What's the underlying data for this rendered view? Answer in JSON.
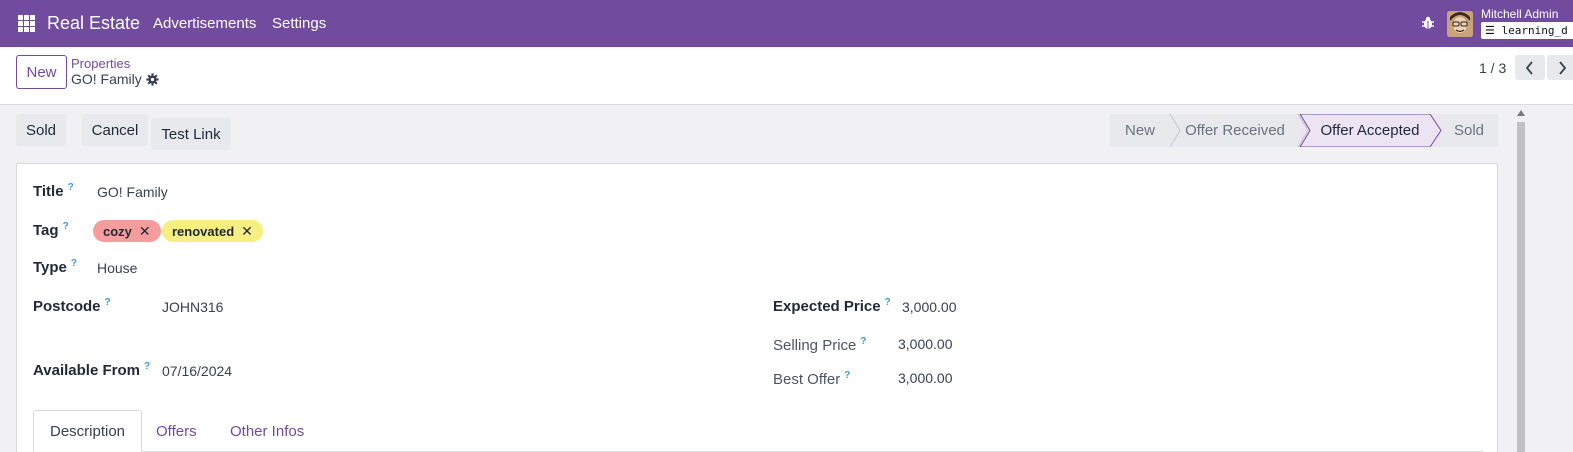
{
  "navbar": {
    "brand": "Real Estate",
    "menu": [
      "Advertisements",
      "Settings"
    ],
    "user_name": "Mitchell Admin",
    "database": "learning_d",
    "color": "#714b9e"
  },
  "control_panel": {
    "new_label": "New",
    "breadcrumb": "Properties",
    "record_name": "GO! Family",
    "pager": "1 / 3"
  },
  "actions": {
    "sold": "Sold",
    "cancel": "Cancel",
    "test_link": "Test Link"
  },
  "statusbar": {
    "stages": [
      "New",
      "Offer Received",
      "Offer Accepted",
      "Sold"
    ],
    "active": "Offer Accepted"
  },
  "form": {
    "title_label": "Title",
    "title_value": "GO! Family",
    "tag_label": "Tag",
    "tags": [
      {
        "name": "cozy",
        "color": "#f59c9c"
      },
      {
        "name": "renovated",
        "color": "#f7ef82"
      }
    ],
    "type_label": "Type",
    "type_value": "House",
    "postcode_label": "Postcode",
    "postcode_value": "JOHN316",
    "available_label": "Available From",
    "available_value": "07/16/2024",
    "expected_label": "Expected Price",
    "expected_value": "3,000.00",
    "selling_label": "Selling Price",
    "selling_value": "3,000.00",
    "best_label": "Best Offer",
    "best_value": "3,000.00",
    "help_mark": "?"
  },
  "tabs": [
    "Description",
    "Offers",
    "Other Infos"
  ]
}
